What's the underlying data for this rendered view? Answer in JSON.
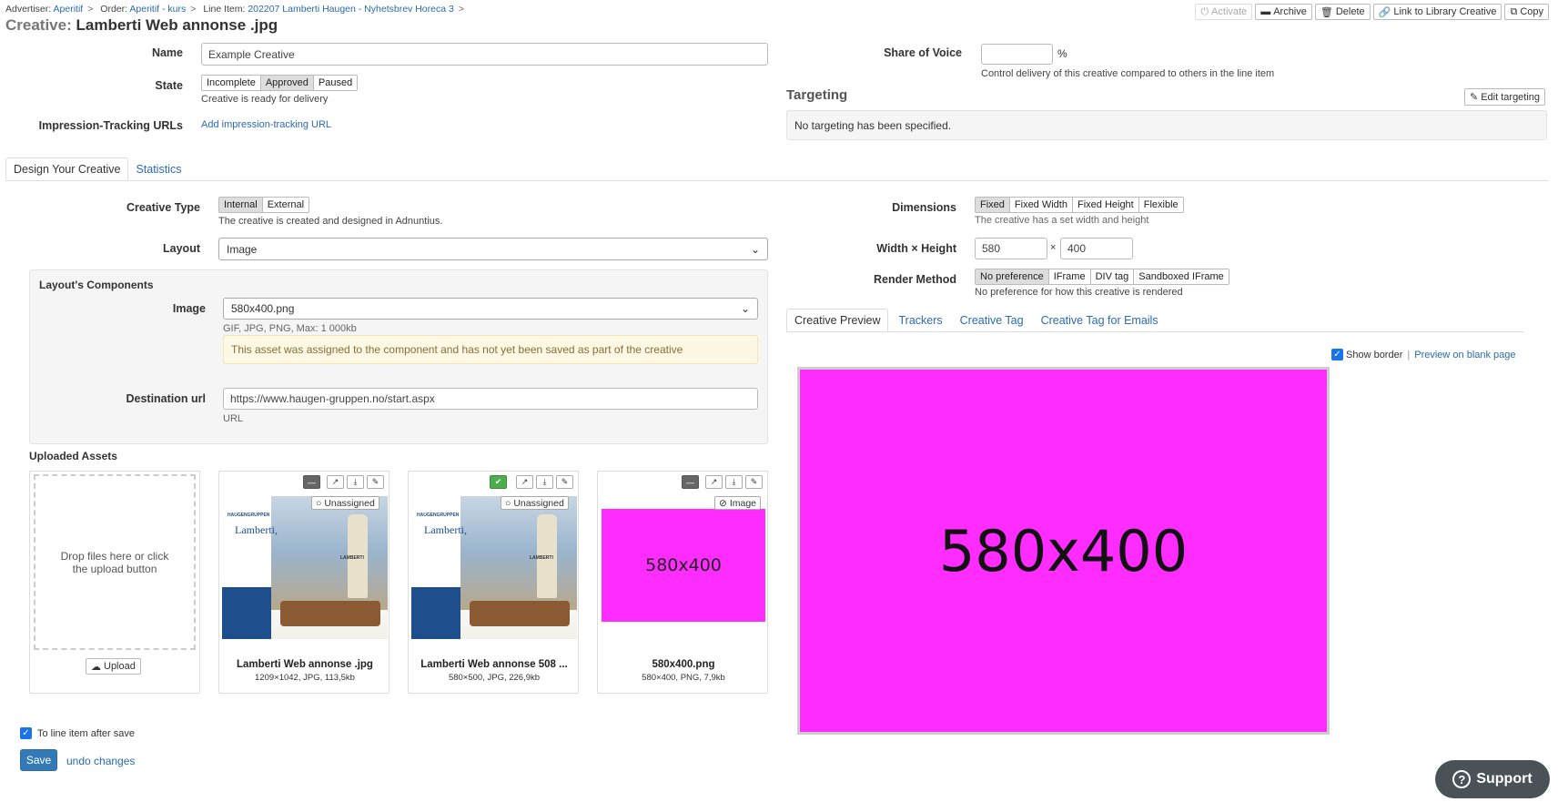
{
  "breadcrumb": {
    "advertiser_label": "Advertiser:",
    "advertiser": "Aperitif",
    "order_label": "Order:",
    "order": "Aperitif - kurs",
    "lineitem_label": "Line Item:",
    "lineitem": "202207 Lamberti Haugen - Nyhetsbrev Horeca 3",
    "sep": ">"
  },
  "title": {
    "prefix": "Creative:",
    "name": "Lamberti Web annonse .jpg"
  },
  "toolbar": {
    "activate": "Activate",
    "archive": "Archive",
    "delete": "Delete",
    "link_library": "Link to Library Creative",
    "copy": "Copy"
  },
  "form": {
    "name_label": "Name",
    "name_value": "Example Creative",
    "state_label": "State",
    "state_options": [
      "Incomplete",
      "Approved",
      "Paused"
    ],
    "state_selected": "Approved",
    "state_help": "Creative is ready for delivery",
    "impression_label": "Impression-Tracking URLs",
    "impression_link": "Add impression-tracking URL",
    "sov_label": "Share of Voice",
    "sov_value": "",
    "sov_unit": "%",
    "sov_help": "Control delivery of this creative compared to others in the line item"
  },
  "targeting": {
    "heading": "Targeting",
    "edit": "Edit targeting",
    "empty": "No targeting has been specified."
  },
  "main_tabs": [
    "Design Your Creative",
    "Statistics"
  ],
  "design": {
    "type_label": "Creative Type",
    "type_options": [
      "Internal",
      "External"
    ],
    "type_selected": "Internal",
    "type_help": "The creative is created and designed in Adnuntius.",
    "layout_label": "Layout",
    "layout_value": "Image",
    "components_heading": "Layout's Components",
    "image_label": "Image",
    "image_value": "580x400.png",
    "image_help": "GIF, JPG, PNG, Max: 1 000kb",
    "image_warning": "This asset was assigned to the component and has not yet been saved as part of the creative",
    "dest_label": "Destination url",
    "dest_value": "https://www.haugen-gruppen.no/start.aspx",
    "dest_help": "URL",
    "dimensions_label": "Dimensions",
    "dimension_options": [
      "Fixed",
      "Fixed Width",
      "Fixed Height",
      "Flexible"
    ],
    "dimension_selected": "Fixed",
    "dimension_help": "The creative has a set width and height",
    "wh_label": "Width × Height",
    "width": "580",
    "times": "×",
    "height": "400",
    "render_label": "Render Method",
    "render_options": [
      "No preference",
      "IFrame",
      "DIV tag",
      "Sandboxed IFrame"
    ],
    "render_selected": "No preference",
    "render_help": "No preference for how this creative is rendered"
  },
  "assets": {
    "heading": "Uploaded Assets",
    "drop_text": "Drop files here or click the upload button",
    "upload": "Upload",
    "items": [
      {
        "name": "Lamberti Web annonse .jpg",
        "meta": "1209×1042, JPG, 113,5kb",
        "status": "Unassigned"
      },
      {
        "name": "Lamberti Web annonse 508 ...",
        "meta": "580×500, JPG, 226,9kb",
        "status": "Unassigned"
      },
      {
        "name": "580x400.png",
        "meta": "580×400, PNG, 7,9kb",
        "status": "Image",
        "thumb_text": "580x400"
      }
    ],
    "ad_brand": "HAUGENGRUPPEN",
    "ad_headline": "Lamberti,",
    "ad_bottle": "LAMBERTI"
  },
  "preview": {
    "tabs": [
      "Creative Preview",
      "Trackers",
      "Creative Tag",
      "Creative Tag for Emails"
    ],
    "show_border": "Show border",
    "divider": "|",
    "blank_page": "Preview on blank page",
    "image_text": "580x400",
    "color": "#ff2cff"
  },
  "footer": {
    "to_line_item": "To line item after save",
    "save": "Save",
    "undo": "undo changes"
  },
  "support": "Support"
}
